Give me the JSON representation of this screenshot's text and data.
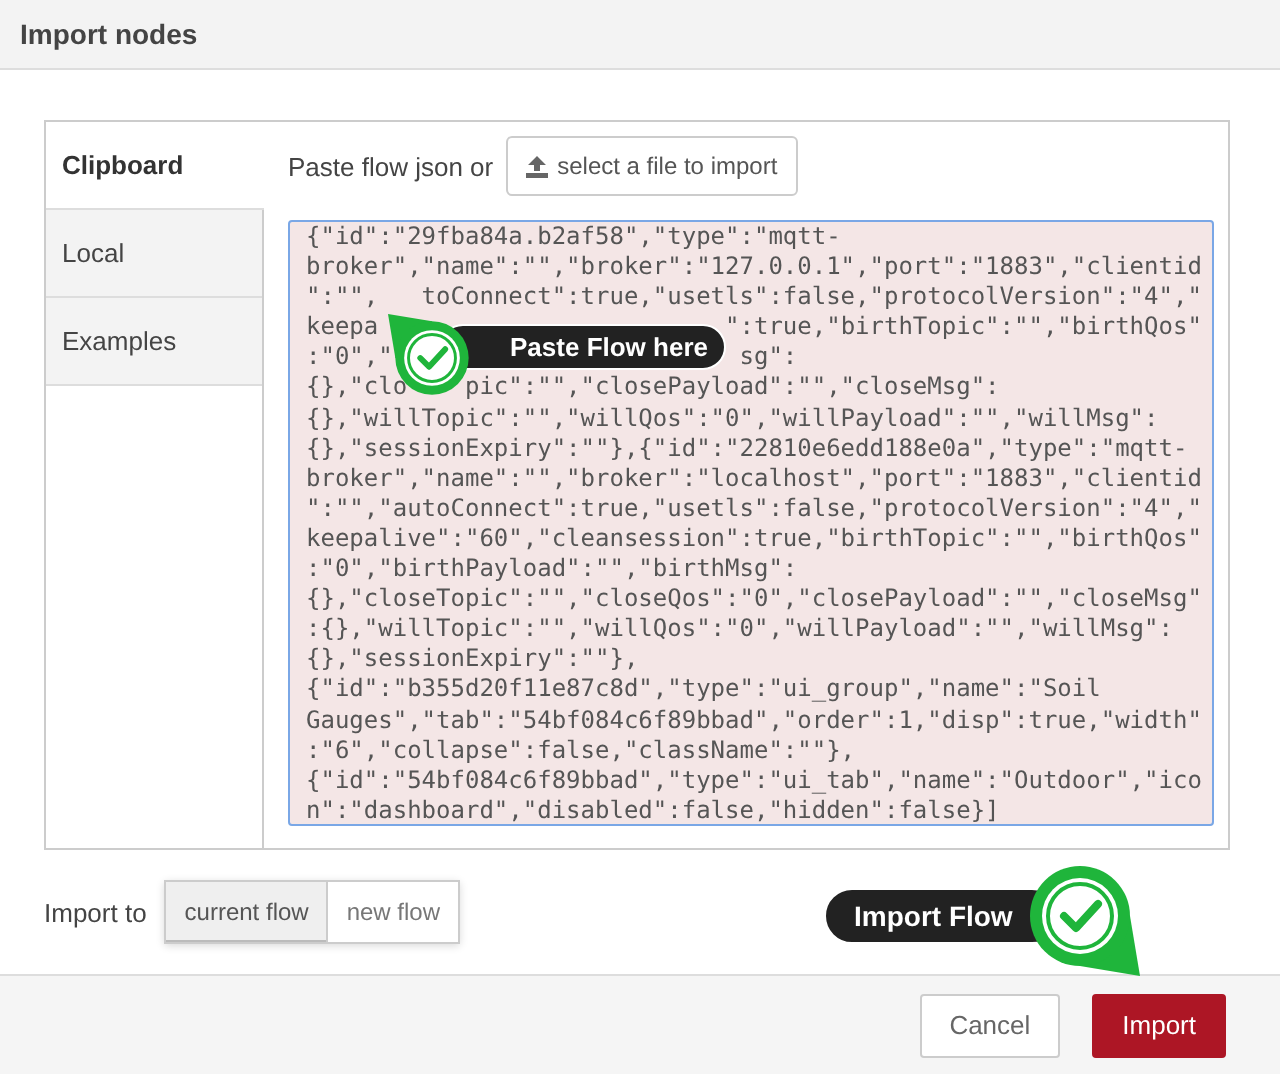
{
  "dialog": {
    "title": "Import nodes"
  },
  "tabs": [
    {
      "label": "Clipboard",
      "selected": true
    },
    {
      "label": "Local",
      "selected": false
    },
    {
      "label": "Examples",
      "selected": false
    }
  ],
  "paste_prompt": "Paste flow json or",
  "file_button": "select a file to import",
  "flow_text": [
    [
      "{\"id\":\"29fba84a.b2af58\",\"type\":\"mqtt-"
    ],
    [
      "broker\",\"name\":\"\",\"broker\":\"127.0.0.1\",\"port\":\"1883\",\"clientid"
    ],
    [
      "\":\"\",",
      "toConnect\":true,\"usetls\":false,\"protocolVersion\":\"4\",\""
    ],
    [
      "keepa",
      "\":true,\"birthTopic\":\"\",\"birthQos\""
    ],
    [
      ":\"0\",\"",
      "sg\":"
    ],
    [
      "{},\"clo",
      "pic\":\"\",\"closePayload\":\"\",\"closeMsg\":"
    ],
    [
      "{},\"willTopic\":\"\",\"willQos\":\"0\",\"willPayload\":\"\",\"willMsg\":"
    ],
    [
      "{},\"sessionExpiry\":\"\"},{\"id\":\"22810e6edd188e0a\",\"type\":\"mqtt-"
    ],
    [
      "broker\",\"name\":\"\",\"broker\":\"localhost\",\"port\":\"1883\",\"clientid"
    ],
    [
      "\":\"\",\"autoConnect\":true,\"usetls\":false,\"protocolVersion\":\"4\",\""
    ],
    [
      "keepalive\":\"60\",\"cleansession\":true,\"birthTopic\":\"\",\"birthQos\""
    ],
    [
      ":\"0\",\"birthPayload\":\"\",\"birthMsg\":"
    ],
    [
      "{},\"closeTopic\":\"\",\"closeQos\":\"0\",\"closePayload\":\"\",\"closeMsg\""
    ],
    [
      ":{},\"willTopic\":\"\",\"willQos\":\"0\",\"willPayload\":\"\",\"willMsg\":"
    ],
    [
      "{},\"sessionExpiry\":\"\"},"
    ],
    [
      "{\"id\":\"b355d20f11e87c8d\",\"type\":\"ui_group\",\"name\":\"Soil"
    ],
    [
      "Gauges\",\"tab\":\"54bf084c6f89bbad\",\"order\":1,\"disp\":true,\"width\""
    ],
    [
      ":\"6\",\"collapse\":false,\"className\":\"\"},"
    ],
    [
      "{\"id\":\"54bf084c6f89bbad\",\"type\":\"ui_tab\",\"name\":\"Outdoor\",\"ico"
    ],
    [
      "n\":\"dashboard\",\"disabled\":false,\"hidden\":false}]"
    ]
  ],
  "callouts": [
    {
      "label": "Paste Flow here"
    },
    {
      "label": "Import Flow"
    }
  ],
  "import_to": {
    "label": "Import to",
    "options": [
      {
        "label": "current flow",
        "selected": true
      },
      {
        "label": "new flow",
        "selected": false
      }
    ]
  },
  "buttons": [
    {
      "label": "Cancel",
      "kind": "secondary"
    },
    {
      "label": "Import",
      "kind": "primary"
    }
  ]
}
